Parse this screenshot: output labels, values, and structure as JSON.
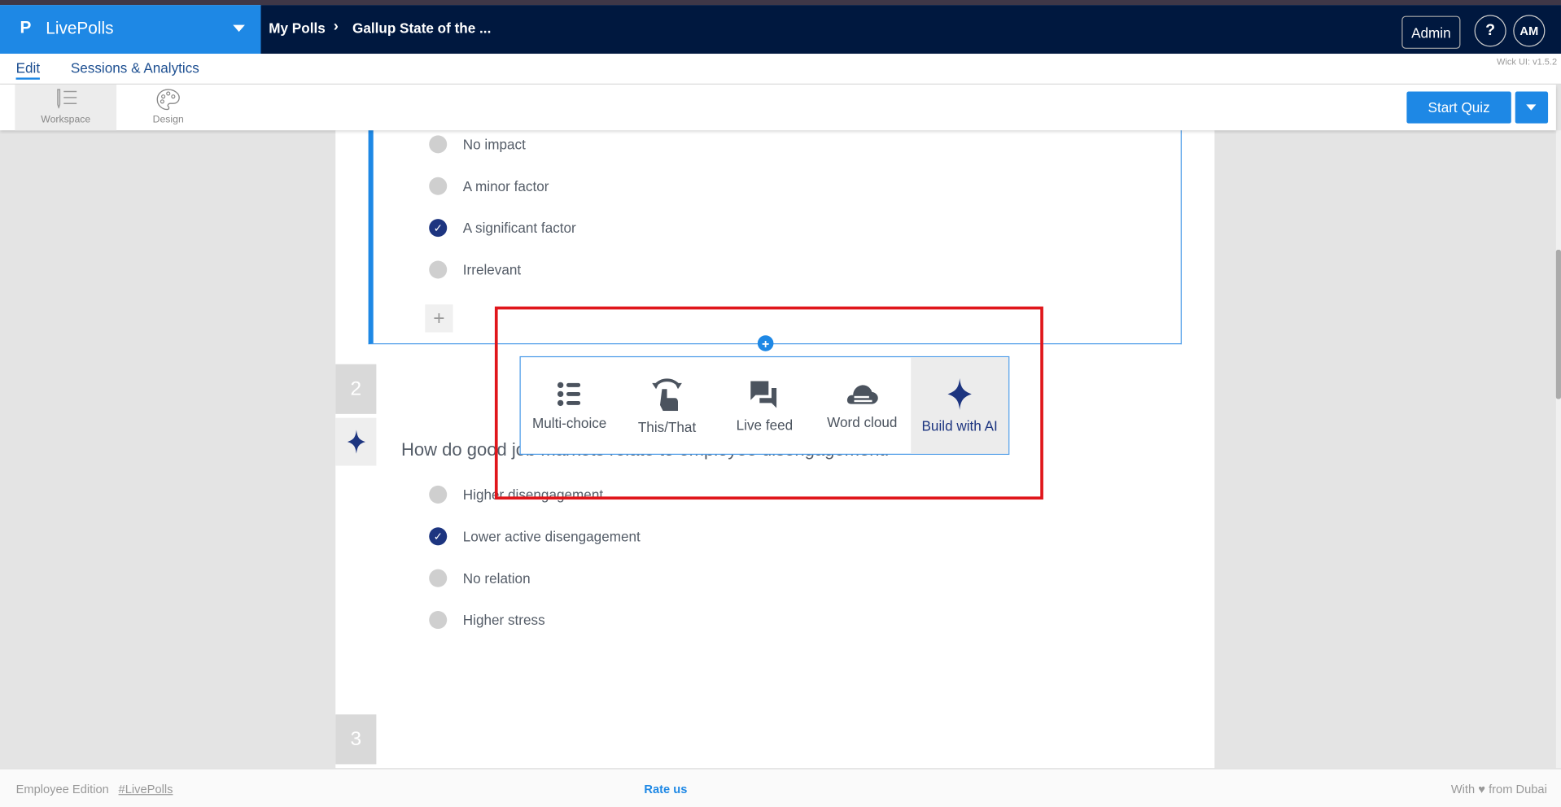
{
  "header": {
    "brand": "LivePolls",
    "breadcrumb": [
      "My Polls",
      "Gallup State of the ..."
    ],
    "admin_label": "Admin",
    "help_label": "?",
    "avatar_initials": "AM"
  },
  "tabs": {
    "edit": "Edit",
    "sessions": "Sessions & Analytics",
    "version": "Wick UI: v1.5.2"
  },
  "toolbar": {
    "workspace": "Workspace",
    "design": "Design",
    "start_quiz": "Start Quiz"
  },
  "questions": [
    {
      "options": [
        {
          "label": "No impact",
          "correct": false
        },
        {
          "label": "A minor factor",
          "correct": false
        },
        {
          "label": "A significant factor",
          "correct": true
        },
        {
          "label": "Irrelevant",
          "correct": false
        }
      ]
    },
    {
      "number": "2",
      "text": "How do good job markets relate to employee disengagement.",
      "options": [
        {
          "label": "Higher disengagement",
          "correct": false
        },
        {
          "label": "Lower active disengagement",
          "correct": true
        },
        {
          "label": "No relation",
          "correct": false
        },
        {
          "label": "Higher stress",
          "correct": false
        }
      ]
    },
    {
      "number": "3"
    }
  ],
  "add_menu": {
    "items": [
      "Multi-choice",
      "This/That",
      "Live feed",
      "Word cloud",
      "Build with AI"
    ]
  },
  "footer": {
    "edition": "Employee Edition",
    "hashtag": "#LivePolls",
    "rate": "Rate us",
    "with": "With",
    "from": "from Dubai"
  },
  "colors": {
    "brand": "#1e88e5",
    "nav": "#00183f",
    "correct": "#1d3580",
    "highlight": "#e0161b"
  }
}
